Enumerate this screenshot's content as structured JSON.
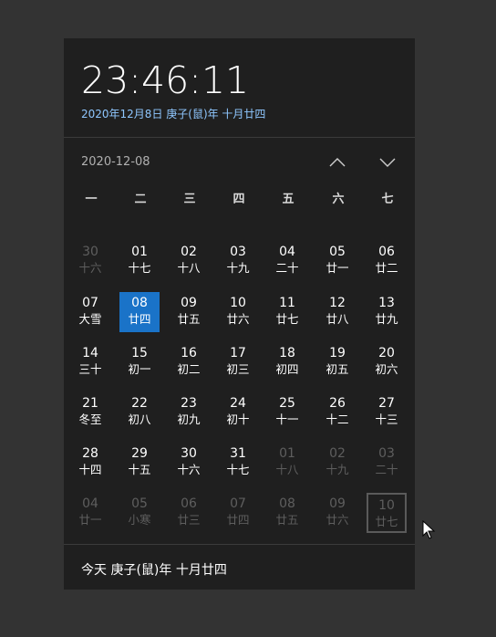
{
  "clock": {
    "time": "23:46:11",
    "date_line": "2020年12月8日 庚子(鼠)年 十月廿四"
  },
  "month": {
    "label": "2020-12-08"
  },
  "weekdays": [
    "一",
    "二",
    "三",
    "四",
    "五",
    "六",
    "七"
  ],
  "days": [
    {
      "n": "30",
      "l": "十六",
      "other": true
    },
    {
      "n": "01",
      "l": "十七"
    },
    {
      "n": "02",
      "l": "十八"
    },
    {
      "n": "03",
      "l": "十九"
    },
    {
      "n": "04",
      "l": "二十"
    },
    {
      "n": "05",
      "l": "廿一"
    },
    {
      "n": "06",
      "l": "廿二"
    },
    {
      "n": "07",
      "l": "大雪"
    },
    {
      "n": "08",
      "l": "廿四",
      "today": true
    },
    {
      "n": "09",
      "l": "廿五"
    },
    {
      "n": "10",
      "l": "廿六"
    },
    {
      "n": "11",
      "l": "廿七"
    },
    {
      "n": "12",
      "l": "廿八"
    },
    {
      "n": "13",
      "l": "廿九"
    },
    {
      "n": "14",
      "l": "三十"
    },
    {
      "n": "15",
      "l": "初一"
    },
    {
      "n": "16",
      "l": "初二"
    },
    {
      "n": "17",
      "l": "初三"
    },
    {
      "n": "18",
      "l": "初四"
    },
    {
      "n": "19",
      "l": "初五"
    },
    {
      "n": "20",
      "l": "初六"
    },
    {
      "n": "21",
      "l": "冬至"
    },
    {
      "n": "22",
      "l": "初八"
    },
    {
      "n": "23",
      "l": "初九"
    },
    {
      "n": "24",
      "l": "初十"
    },
    {
      "n": "25",
      "l": "十一"
    },
    {
      "n": "26",
      "l": "十二"
    },
    {
      "n": "27",
      "l": "十三"
    },
    {
      "n": "28",
      "l": "十四"
    },
    {
      "n": "29",
      "l": "十五"
    },
    {
      "n": "30",
      "l": "十六"
    },
    {
      "n": "31",
      "l": "十七"
    },
    {
      "n": "01",
      "l": "十八",
      "other": true
    },
    {
      "n": "02",
      "l": "十九",
      "other": true
    },
    {
      "n": "03",
      "l": "二十",
      "other": true
    },
    {
      "n": "04",
      "l": "廿一",
      "other": true
    },
    {
      "n": "05",
      "l": "小寒",
      "other": true
    },
    {
      "n": "06",
      "l": "廿三",
      "other": true
    },
    {
      "n": "07",
      "l": "廿四",
      "other": true
    },
    {
      "n": "08",
      "l": "廿五",
      "other": true
    },
    {
      "n": "09",
      "l": "廿六",
      "other": true
    },
    {
      "n": "10",
      "l": "廿七",
      "other": true,
      "hover": true
    }
  ],
  "footer": {
    "text": "今天 庚子(鼠)年 十月廿四"
  },
  "colors": {
    "accent": "#1a73c8",
    "date_line": "#8fc7ff",
    "panel": "#1f1f1f"
  }
}
